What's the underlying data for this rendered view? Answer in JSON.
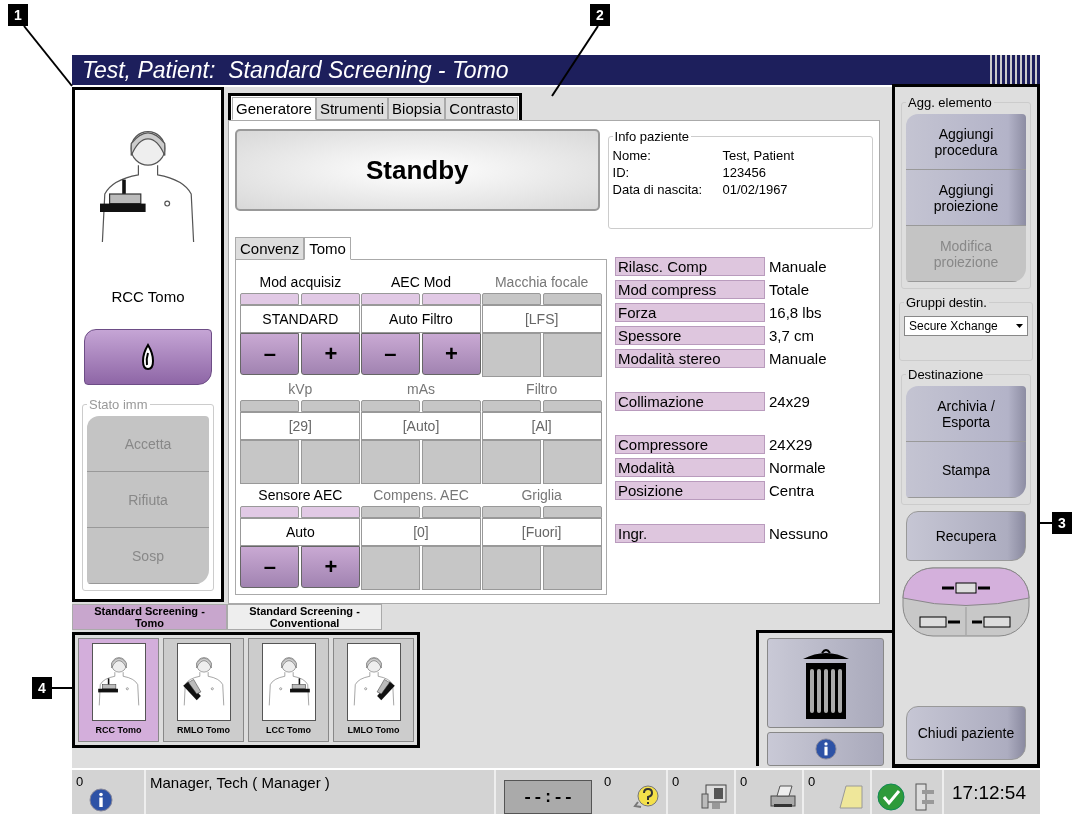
{
  "window": {
    "title": "Test, Patient:  Standard Screening - Tomo"
  },
  "left_panel": {
    "view_label": "RCC Tomo",
    "image_status": {
      "legend": "Stato imm",
      "buttons": [
        {
          "label": "Accetta",
          "disabled": true
        },
        {
          "label": "Rifiuta",
          "disabled": true
        },
        {
          "label": "Sosp",
          "disabled": true
        }
      ]
    }
  },
  "tabs": [
    {
      "label": "Generatore",
      "selected": true
    },
    {
      "label": "Strumenti",
      "selected": false
    },
    {
      "label": "Biopsia",
      "selected": false
    },
    {
      "label": "Contrasto",
      "selected": false
    }
  ],
  "standby_button": "Standby",
  "patient_info": {
    "legend": "Info paziente",
    "fields": [
      {
        "label": "Nome:",
        "value": "Test, Patient"
      },
      {
        "label": "ID:",
        "value": "123456"
      },
      {
        "label": "Data di nascita:",
        "value": "01/02/1967"
      }
    ]
  },
  "mode_tabs": [
    {
      "label": "Convenz",
      "selected": false
    },
    {
      "label": "Tomo",
      "selected": true
    }
  ],
  "controls": [
    {
      "label": "Mod acquisiz",
      "value": "STANDARD",
      "disabled": false,
      "decrement": "–",
      "increment": "+"
    },
    {
      "label": "AEC Mod",
      "value": "Auto Filtro",
      "disabled": false,
      "decrement": "–",
      "increment": "+"
    },
    {
      "label": "Macchia focale",
      "value": "[LFS]",
      "disabled": true
    },
    {
      "label": "kVp",
      "value": "[29]",
      "disabled": true
    },
    {
      "label": "mAs",
      "value": "[Auto]",
      "disabled": true
    },
    {
      "label": "Filtro",
      "value": "[Al]",
      "disabled": true
    },
    {
      "label": "Sensore AEC",
      "value": "Auto",
      "disabled": false,
      "decrement": "–",
      "increment": "+"
    },
    {
      "label": "Compens. AEC",
      "value": "[0]",
      "disabled": true
    },
    {
      "label": "Griglia",
      "value": "[Fuori]",
      "disabled": true
    }
  ],
  "property_groups": [
    [
      {
        "label": "Rilasc. Comp",
        "value": "Manuale"
      },
      {
        "label": "Mod compress",
        "value": "Totale"
      },
      {
        "label": "Forza",
        "value": "16,8 lbs"
      },
      {
        "label": "Spessore",
        "value": "3,7 cm"
      },
      {
        "label": "Modalità stereo",
        "value": "Manuale"
      }
    ],
    [
      {
        "label": "Collimazione",
        "value": "24x29"
      }
    ],
    [
      {
        "label": "Compressore",
        "value": "24X29"
      },
      {
        "label": "Modalità",
        "value": "Normale"
      },
      {
        "label": "Posizione",
        "value": "Centra"
      }
    ],
    [
      {
        "label": "Ingr.",
        "value": "Nessuno"
      }
    ]
  ],
  "procedure_tabs": [
    {
      "label": "Standard Screening - Tomo",
      "selected": true
    },
    {
      "label": "Standard Screening - Conventional",
      "selected": false
    }
  ],
  "thumbnails": [
    {
      "label": "RCC Tomo",
      "selected": true,
      "kind": "rcc"
    },
    {
      "label": "RMLO Tomo",
      "selected": false,
      "kind": "rmlo"
    },
    {
      "label": "LCC Tomo",
      "selected": false,
      "kind": "lcc"
    },
    {
      "label": "LMLO Tomo",
      "selected": false,
      "kind": "lmlo"
    }
  ],
  "right_panel": {
    "add_item": {
      "legend": "Agg. elemento",
      "buttons": [
        {
          "label": "Aggiungi procedura",
          "disabled": false
        },
        {
          "label": "Aggiungi proiezione",
          "disabled": false
        },
        {
          "label": "Modifica proiezione",
          "disabled": true
        }
      ]
    },
    "output_groups": {
      "legend": "Gruppi destin.",
      "value": "Secure Xchange"
    },
    "destination": {
      "legend": "Destinazione",
      "buttons": [
        "Archivia / Esporta",
        "Stampa"
      ]
    },
    "retrieve_button": "Recupera",
    "close_button": "Chiudi paziente"
  },
  "status_bar": {
    "alerts_count": "0",
    "user": "Manager, Tech ( Manager )",
    "timer": "--:--",
    "counters": [
      {
        "count": "0",
        "kind": "help"
      },
      {
        "count": "0",
        "kind": "monitor"
      },
      {
        "count": "0",
        "kind": "printer"
      },
      {
        "count": "0",
        "kind": "notes"
      }
    ],
    "time": "17:12:54"
  },
  "callouts": [
    "1",
    "2",
    "3",
    "4"
  ]
}
